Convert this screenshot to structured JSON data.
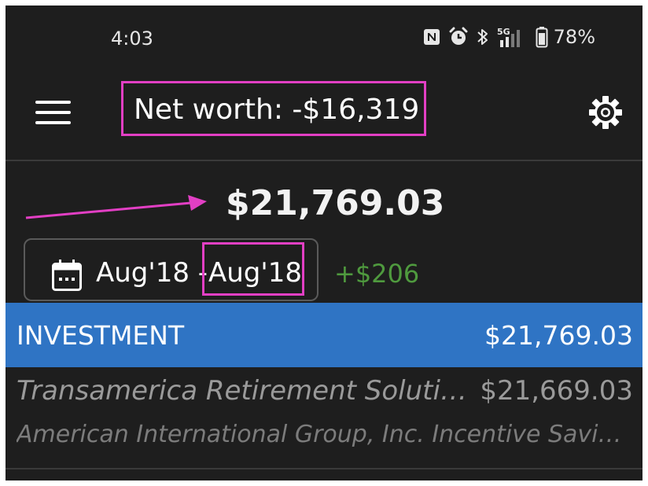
{
  "status_bar": {
    "time": "4:03",
    "icons": [
      "nfc-icon",
      "alarm-icon",
      "bluetooth-icon",
      "signal-5g-icon",
      "battery-icon"
    ],
    "network": "5G",
    "battery_percent": "78%"
  },
  "header": {
    "title": "Net worth: -$16,319",
    "menu_icon": "menu-icon",
    "settings_icon": "gear-icon"
  },
  "summary": {
    "balance": "$21,769.03",
    "date_start": "Aug'18 -",
    "date_end": "Aug'18",
    "change": "+$206",
    "change_color": "#4f9a3e"
  },
  "category": {
    "name": "INVESTMENT",
    "total": "$21,769.03",
    "color": "#2f74c4"
  },
  "accounts": [
    {
      "name": "Transamerica Retirement Solutions",
      "balance": "$21,669.03",
      "institution": "American International Group, Inc. Incentive Savings Plan"
    }
  ],
  "annotations": {
    "highlight_color": "#e23fc4"
  }
}
